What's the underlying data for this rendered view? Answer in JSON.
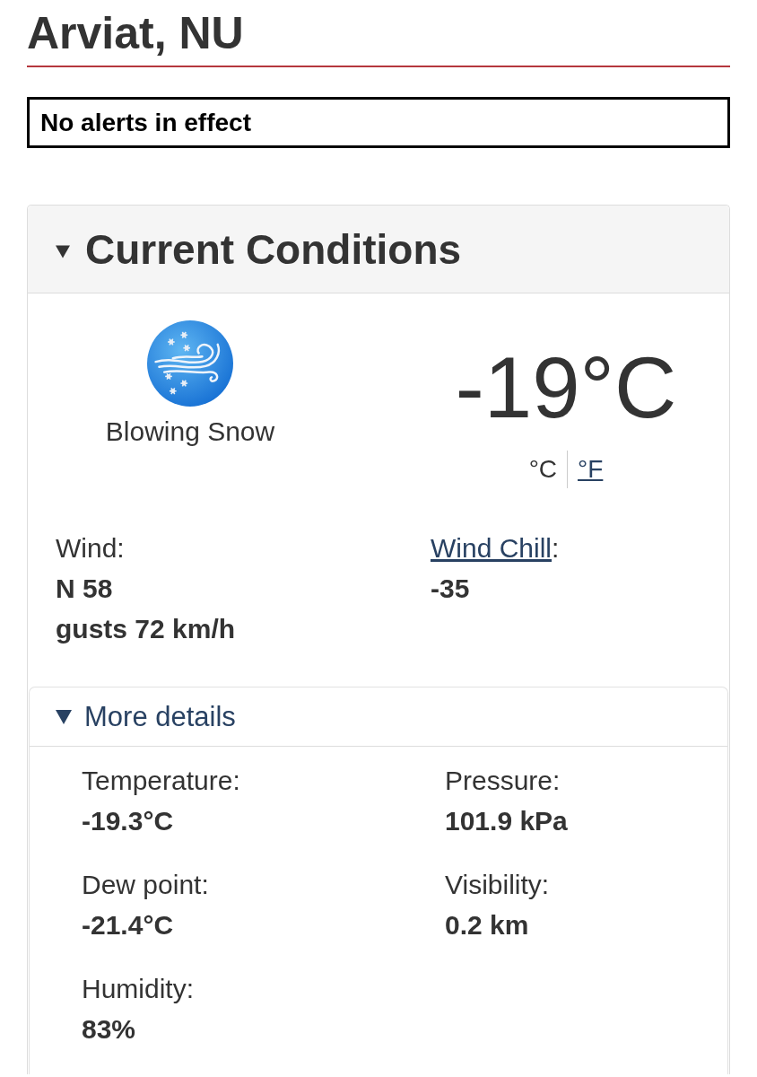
{
  "location": {
    "title": "Arviat, NU"
  },
  "alert": {
    "text": "No alerts in effect"
  },
  "current_conditions": {
    "title": "Current Conditions",
    "expanded": true,
    "condition": {
      "label": "Blowing Snow"
    },
    "temperature": "-19°C",
    "units": [
      {
        "label": "°C",
        "selected": true
      },
      {
        "label": "°F",
        "selected": false
      }
    ],
    "observations": [
      {
        "label": "Wind",
        "suffix": ":",
        "link": false,
        "lines": [
          "N 58",
          "gusts 72 km/h"
        ]
      },
      {
        "label": "Wind Chill",
        "suffix": ":",
        "link": true,
        "lines": [
          "-35"
        ]
      }
    ],
    "more_details": {
      "title": "More details",
      "expanded": true,
      "columns": [
        [
          {
            "label": "Temperature:",
            "value": "-19.3°C"
          },
          {
            "label": "Dew point:",
            "value": "-21.4°C"
          },
          {
            "label": "Humidity:",
            "value": "83%"
          }
        ],
        [
          {
            "label": "Pressure:",
            "value": "101.9 kPa"
          },
          {
            "label": "Visibility:",
            "value": "0.2 km"
          }
        ]
      ]
    }
  }
}
